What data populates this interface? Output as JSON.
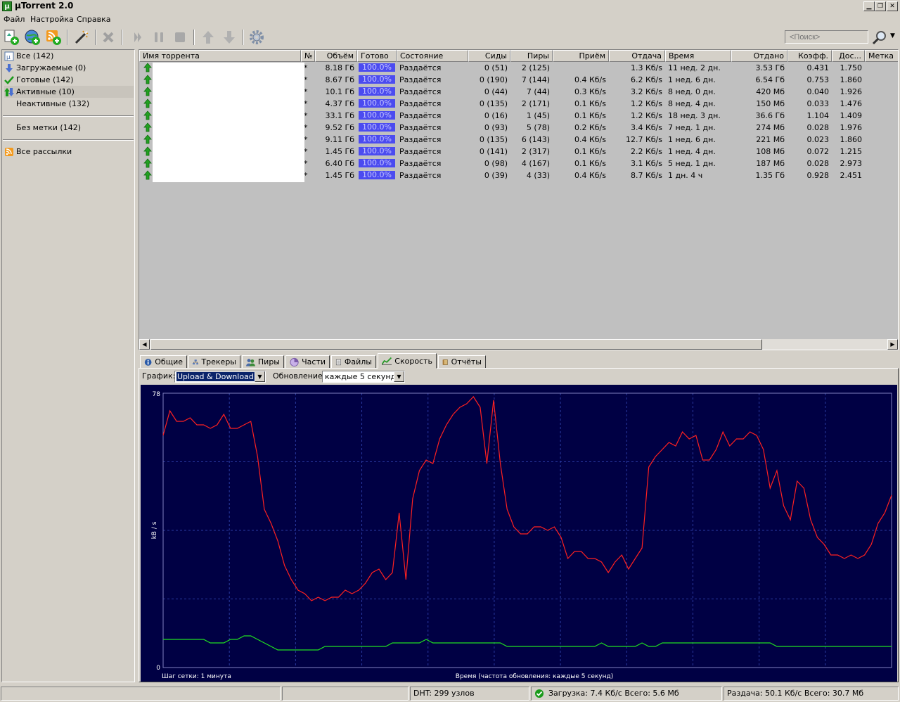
{
  "window": {
    "title": "µTorrent 2.0",
    "icon_letter": "µ"
  },
  "menu": [
    "Файл",
    "Настройка",
    "Справка"
  ],
  "search": {
    "placeholder": "<Поиск>"
  },
  "sidebar": {
    "items": [
      {
        "label": "Все (142)",
        "icon": "all-torrents-icon"
      },
      {
        "label": "Загружаемые (0)",
        "icon": "download-arrow-icon"
      },
      {
        "label": "Готовые (142)",
        "icon": "checkmark-icon"
      },
      {
        "label": "Активные (10)",
        "icon": "active-arrows-icon"
      },
      {
        "label": "Неактивные (132)",
        "icon": "inactive-icon"
      }
    ],
    "no_label": "Без метки (142)",
    "feeds": "Все рассылки"
  },
  "columns": [
    "Имя торрента",
    "№",
    "Объём",
    "Готово",
    "Состояние",
    "Сиды",
    "Пиры",
    "Приём",
    "Отдача",
    "Время",
    "Отдано",
    "Коэфф.",
    "Дос...",
    "Метка"
  ],
  "torrents": [
    {
      "num": "*",
      "size": "8.18 Гб",
      "done": "100.0%",
      "status": "Раздаётся",
      "seeds": "0 (51)",
      "peers": "2 (125)",
      "down": "",
      "up": "1.3 Кб/s",
      "time": "11 нед. 2 дн.",
      "uploaded": "3.53 Гб",
      "ratio": "0.431",
      "avail": "1.750"
    },
    {
      "num": "*",
      "size": "8.67 Гб",
      "done": "100.0%",
      "status": "Раздаётся",
      "seeds": "0 (190)",
      "peers": "7 (144)",
      "down": "0.4 Кб/s",
      "up": "6.2 Кб/s",
      "time": "1 нед. 6 дн.",
      "uploaded": "6.54 Гб",
      "ratio": "0.753",
      "avail": "1.860"
    },
    {
      "num": "*",
      "size": "10.1 Гб",
      "done": "100.0%",
      "status": "Раздаётся",
      "seeds": "0 (44)",
      "peers": "7 (44)",
      "down": "0.3 Кб/s",
      "up": "3.2 Кб/s",
      "time": "8 нед. 0 дн.",
      "uploaded": "420 Мб",
      "ratio": "0.040",
      "avail": "1.926"
    },
    {
      "num": "*",
      "size": "4.37 Гб",
      "done": "100.0%",
      "status": "Раздаётся",
      "seeds": "0 (135)",
      "peers": "2 (171)",
      "down": "0.1 Кб/s",
      "up": "1.2 Кб/s",
      "time": "8 нед. 4 дн.",
      "uploaded": "150 Мб",
      "ratio": "0.033",
      "avail": "1.476"
    },
    {
      "num": "*",
      "size": "33.1 Гб",
      "done": "100.0%",
      "status": "Раздаётся",
      "seeds": "0 (16)",
      "peers": "1 (45)",
      "down": "0.1 Кб/s",
      "up": "1.2 Кб/s",
      "time": "18 нед. 3 дн.",
      "uploaded": "36.6 Гб",
      "ratio": "1.104",
      "avail": "1.409"
    },
    {
      "num": "*",
      "size": "9.52 Гб",
      "done": "100.0%",
      "status": "Раздаётся",
      "seeds": "0 (93)",
      "peers": "5 (78)",
      "down": "0.2 Кб/s",
      "up": "3.4 Кб/s",
      "time": "7 нед. 1 дн.",
      "uploaded": "274 Мб",
      "ratio": "0.028",
      "avail": "1.976"
    },
    {
      "num": "*",
      "size": "9.11 Гб",
      "done": "100.0%",
      "status": "Раздаётся",
      "seeds": "0 (135)",
      "peers": "6 (143)",
      "down": "0.4 Кб/s",
      "up": "12.7 Кб/s",
      "time": "1 нед. 6 дн.",
      "uploaded": "221 Мб",
      "ratio": "0.023",
      "avail": "1.860"
    },
    {
      "num": "*",
      "size": "1.45 Гб",
      "done": "100.0%",
      "status": "Раздаётся",
      "seeds": "0 (141)",
      "peers": "2 (317)",
      "down": "0.1 Кб/s",
      "up": "2.2 Кб/s",
      "time": "1 нед. 4 дн.",
      "uploaded": "108 Мб",
      "ratio": "0.072",
      "avail": "1.215"
    },
    {
      "num": "*",
      "size": "6.40 Гб",
      "done": "100.0%",
      "status": "Раздаётся",
      "seeds": "0 (98)",
      "peers": "4 (167)",
      "down": "0.1 Кб/s",
      "up": "3.1 Кб/s",
      "time": "5 нед. 1 дн.",
      "uploaded": "187 Мб",
      "ratio": "0.028",
      "avail": "2.973"
    },
    {
      "num": "*",
      "size": "1.45 Гб",
      "done": "100.0%",
      "status": "Раздаётся",
      "seeds": "0 (39)",
      "peers": "4 (33)",
      "down": "0.4 Кб/s",
      "up": "8.7 Кб/s",
      "time": "1 дн. 4 ч",
      "uploaded": "1.35 Гб",
      "ratio": "0.928",
      "avail": "2.451"
    }
  ],
  "tabs": [
    "Общие",
    "Трекеры",
    "Пиры",
    "Части",
    "Файлы",
    "Скорость",
    "Отчёты"
  ],
  "graph_controls": {
    "graph_label": "График:",
    "graph_value": "Upload & Download",
    "update_label": "Обновление:",
    "update_value": "каждые 5 секунд"
  },
  "chart_data": {
    "type": "line",
    "ylabel": "kB / s",
    "ylim": [
      0,
      78
    ],
    "y_ticks": [
      "78",
      "0"
    ],
    "grid_note": "Шаг сетки: 1 минута",
    "x_caption": "Время (частота обновления: каждые 5 секунд)",
    "colors": {
      "background": "#000044",
      "grid": "#2a3aa0",
      "upload": "#ff2020",
      "download": "#20e020"
    },
    "series": [
      {
        "values": [
          66,
          73,
          70,
          70,
          71,
          69,
          69,
          68,
          69,
          72,
          68,
          68,
          69,
          70,
          60,
          45,
          41,
          36,
          29,
          25,
          22,
          21,
          19,
          20,
          19,
          20,
          20,
          22,
          21,
          22,
          24,
          27,
          28,
          25,
          27,
          44,
          25,
          48,
          56,
          59,
          58,
          65,
          69,
          72,
          74,
          75,
          77,
          74,
          58,
          76,
          58,
          45,
          40,
          38,
          38,
          40,
          40,
          39,
          40,
          37,
          31,
          33,
          33,
          31,
          31,
          30,
          27,
          30,
          32,
          28,
          31,
          34,
          57,
          60,
          62,
          64,
          63,
          67,
          65,
          66,
          59,
          59,
          62,
          67,
          63,
          65,
          65,
          67,
          66,
          62,
          51,
          56,
          46,
          42,
          53,
          51,
          42,
          37,
          35,
          32,
          32,
          31,
          32,
          31,
          32,
          35,
          41,
          44,
          49
        ],
        "name": ""
      },
      {
        "values": [
          8,
          8,
          8,
          8,
          8,
          8,
          8,
          7,
          7,
          7,
          8,
          8,
          9,
          9,
          8,
          7,
          6,
          5,
          5,
          5,
          5,
          5,
          5,
          5,
          6,
          6,
          6,
          6,
          6,
          6,
          6,
          6,
          6,
          6,
          7,
          7,
          7,
          7,
          7,
          8,
          7,
          7,
          7,
          7,
          7,
          7,
          7,
          7,
          7,
          7,
          7,
          6,
          6,
          6,
          6,
          6,
          6,
          6,
          6,
          6,
          6,
          6,
          6,
          6,
          6,
          7,
          6,
          6,
          6,
          6,
          6,
          7,
          6,
          6,
          7,
          7,
          7,
          7,
          7,
          7,
          7,
          7,
          7,
          7,
          7,
          7,
          7,
          7,
          7,
          7,
          7,
          6,
          6,
          6,
          6,
          6,
          6,
          6,
          6,
          6,
          6,
          6,
          6,
          6,
          6,
          6,
          6,
          6,
          6
        ],
        "name": ""
      }
    ]
  },
  "status": {
    "dht": "DHT: 299 узлов",
    "download": "Загрузка: 7.4 Кб/с Всего: 5.6 Мб",
    "upload": "Раздача: 50.1 Кб/с Всего: 30.7 Мб"
  }
}
